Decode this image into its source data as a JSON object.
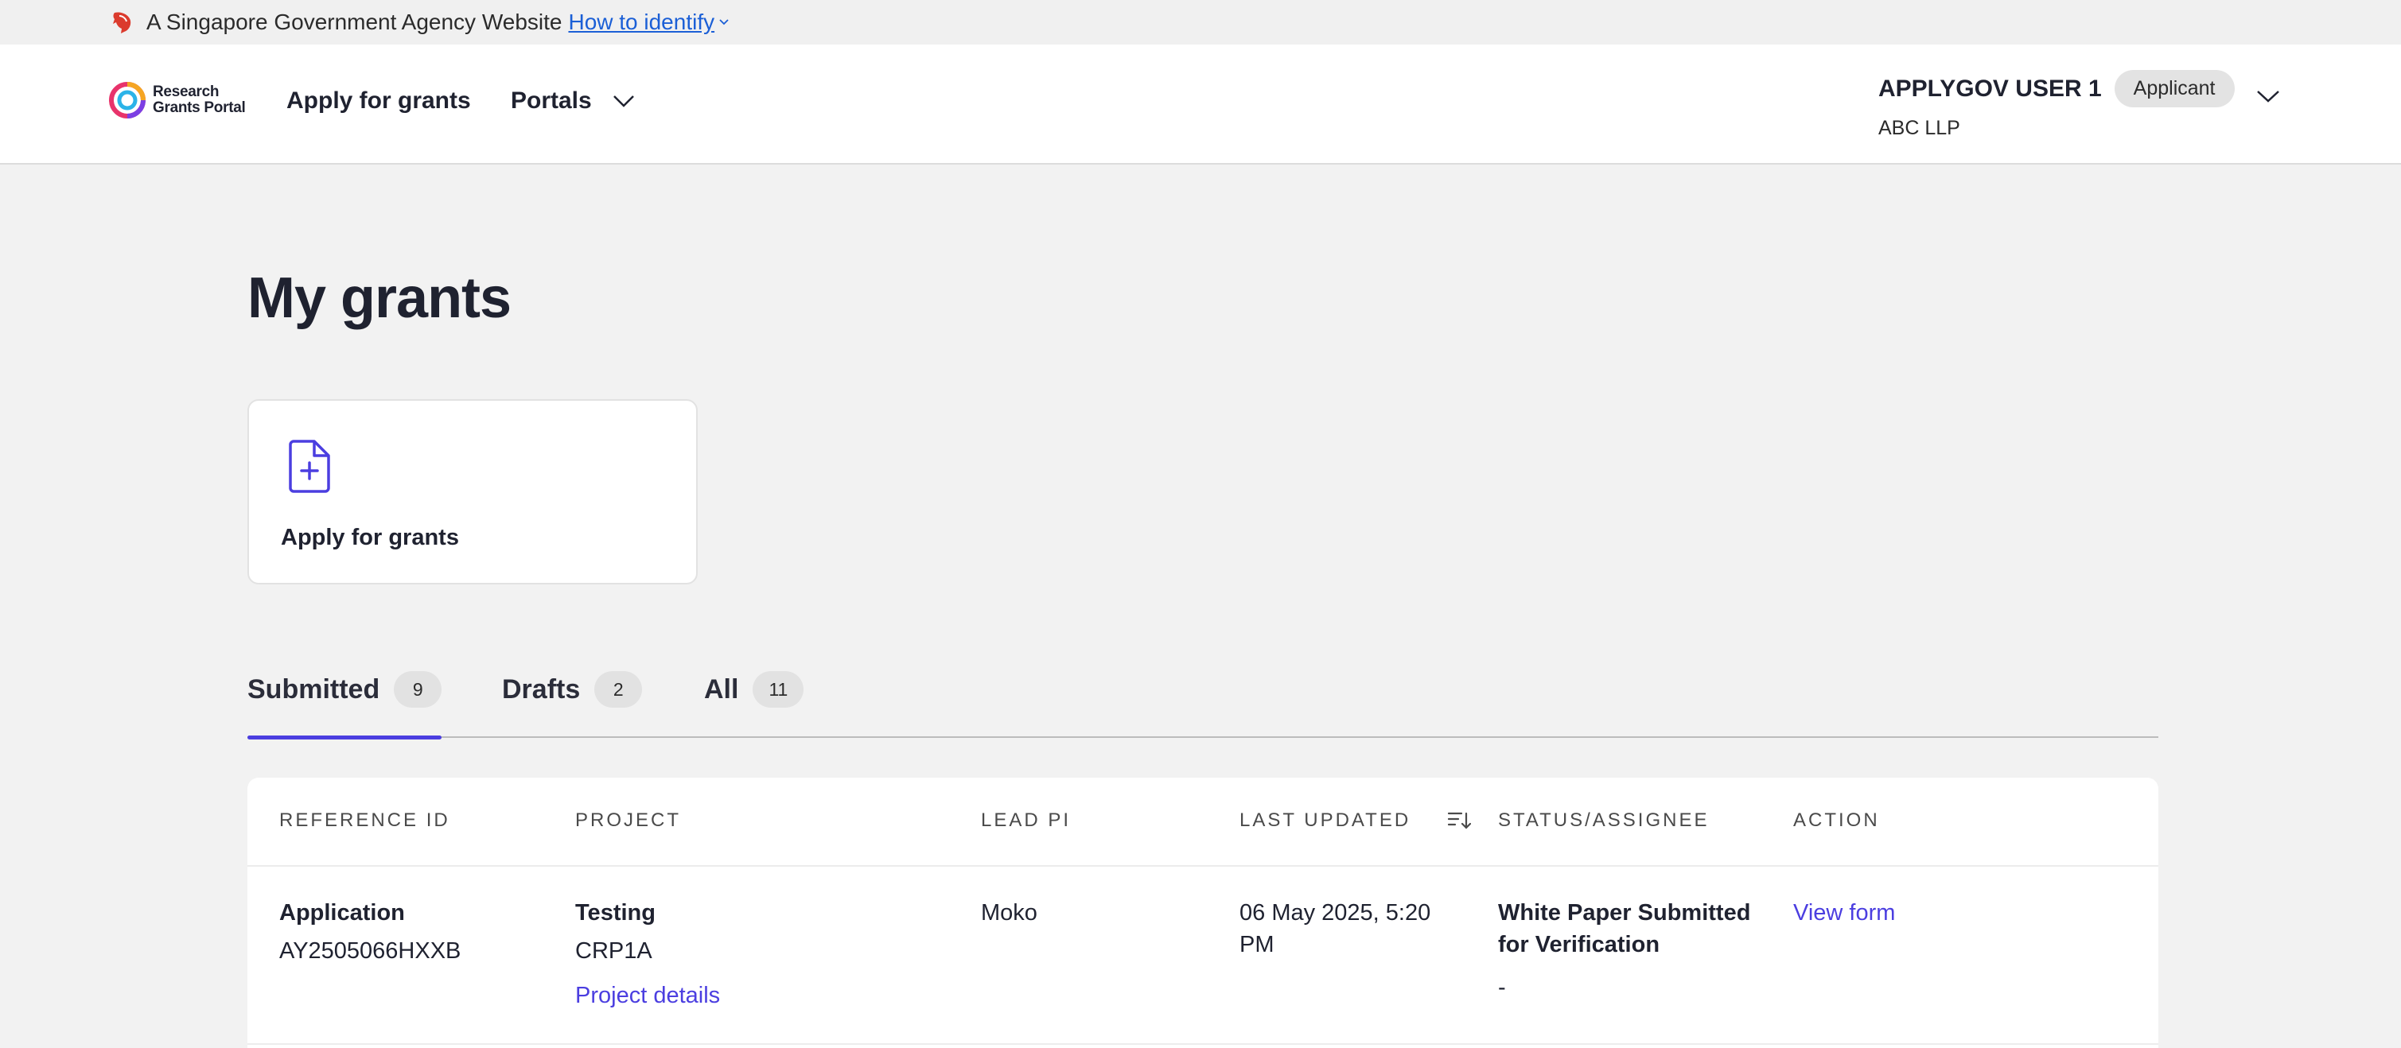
{
  "masthead": {
    "text": "A Singapore Government Agency Website",
    "identify_link": "How to identify"
  },
  "header": {
    "logo_line1": "Research",
    "logo_line2": "Grants Portal",
    "nav": {
      "apply": "Apply for grants",
      "portals": "Portals"
    },
    "user": {
      "name": "APPLYGOV USER 1",
      "role": "Applicant",
      "org": "ABC LLP"
    }
  },
  "page": {
    "title": "My grants"
  },
  "apply_card": {
    "label": "Apply for grants"
  },
  "tabs": [
    {
      "label": "Submitted",
      "count": "9"
    },
    {
      "label": "Drafts",
      "count": "2"
    },
    {
      "label": "All",
      "count": "11"
    }
  ],
  "table": {
    "headers": {
      "reference_id": "REFERENCE ID",
      "project": "PROJECT",
      "lead_pi": "LEAD PI",
      "last_updated": "LAST UPDATED",
      "status": "STATUS/ASSIGNEE",
      "action": "ACTION"
    },
    "rows": [
      {
        "ref_type": "Application",
        "ref_id": "AY2505066HXXB",
        "project_name": "Testing",
        "project_code": "CRP1A",
        "project_link": "Project details",
        "lead_pi": "Moko",
        "updated_line1": "06 May 2025, 5:20",
        "updated_line2": "PM",
        "status_line1": "White Paper Submitted",
        "status_line2": "for Verification",
        "assignee": "-",
        "action": "View form"
      }
    ]
  },
  "colors": {
    "accent": "#4b3ee0",
    "link_blue": "#1b5fd6",
    "background": "#f2f2f2"
  }
}
